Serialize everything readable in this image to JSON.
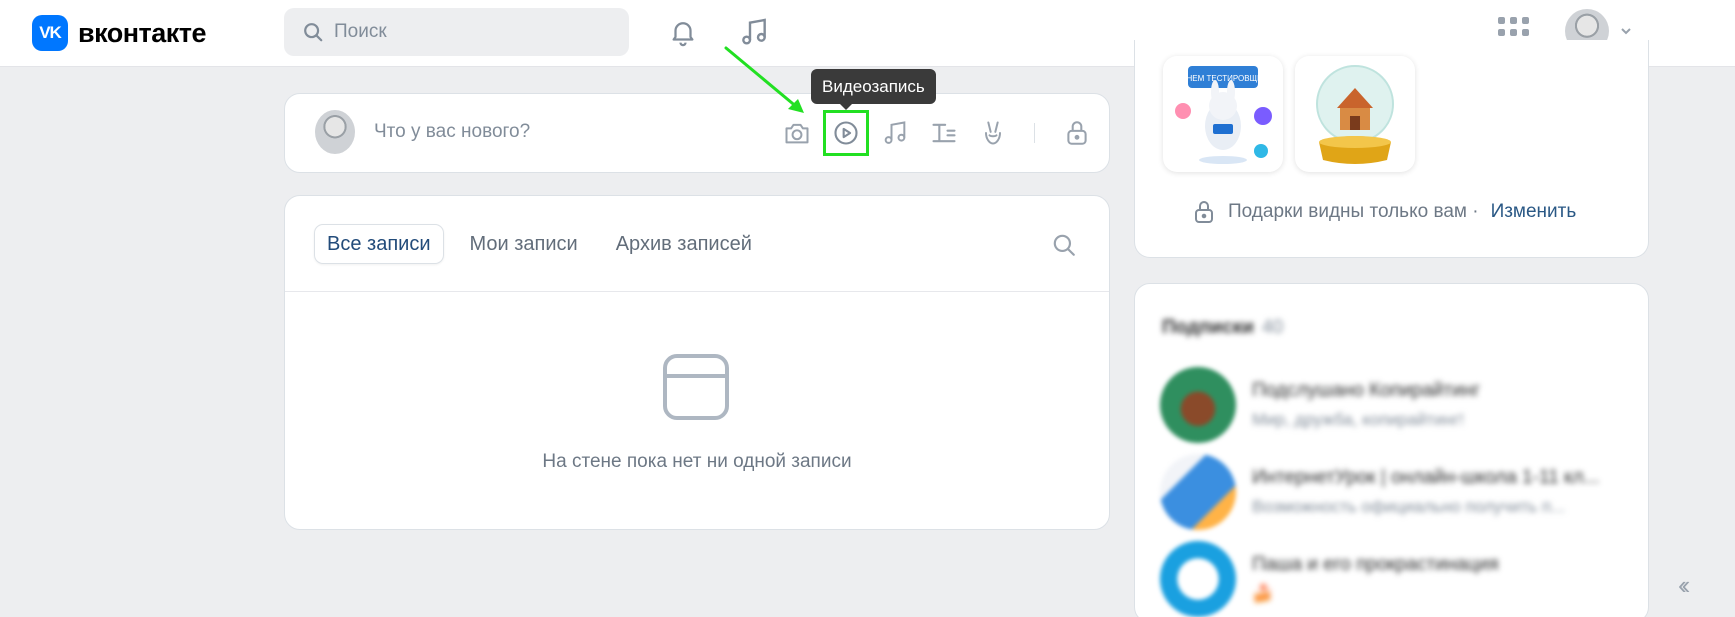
{
  "header": {
    "logo_mark": "VK",
    "logo_text": "вконтакте",
    "search_placeholder": "Поиск"
  },
  "composer": {
    "placeholder": "Что у вас нового?",
    "tools": [
      "camera-icon",
      "video-play-icon",
      "music-note-icon",
      "text-format-icon",
      "peace-hand-icon",
      "lock-icon"
    ]
  },
  "tooltip": {
    "text": "Видеозапись"
  },
  "wall": {
    "tabs": [
      "Все записи",
      "Мои записи",
      "Архив записей"
    ],
    "empty_text": "На стене пока нет ни одной записи"
  },
  "gifts": {
    "gift_1_banner": "С ДНЕМ ТЕСТИРОВЩИКА",
    "privacy_text": "Подарки видны только вам ·",
    "change_link": "Изменить"
  },
  "subscriptions": {
    "title": "Подписки",
    "count": "40",
    "items": [
      {
        "name": "Подслушано Копирайтинг",
        "desc": "Мир, дружба, копирайтинг!"
      },
      {
        "name": "ИнтернетУрок | онлайн-школа 1-11 кл...",
        "desc": "Возможность официально получить п..."
      },
      {
        "name": "Паша и его прокрастинация",
        "desc": "🍰"
      }
    ]
  },
  "colors": {
    "accent": "#0077ff",
    "highlight": "#22e022",
    "link": "#2a5885"
  }
}
